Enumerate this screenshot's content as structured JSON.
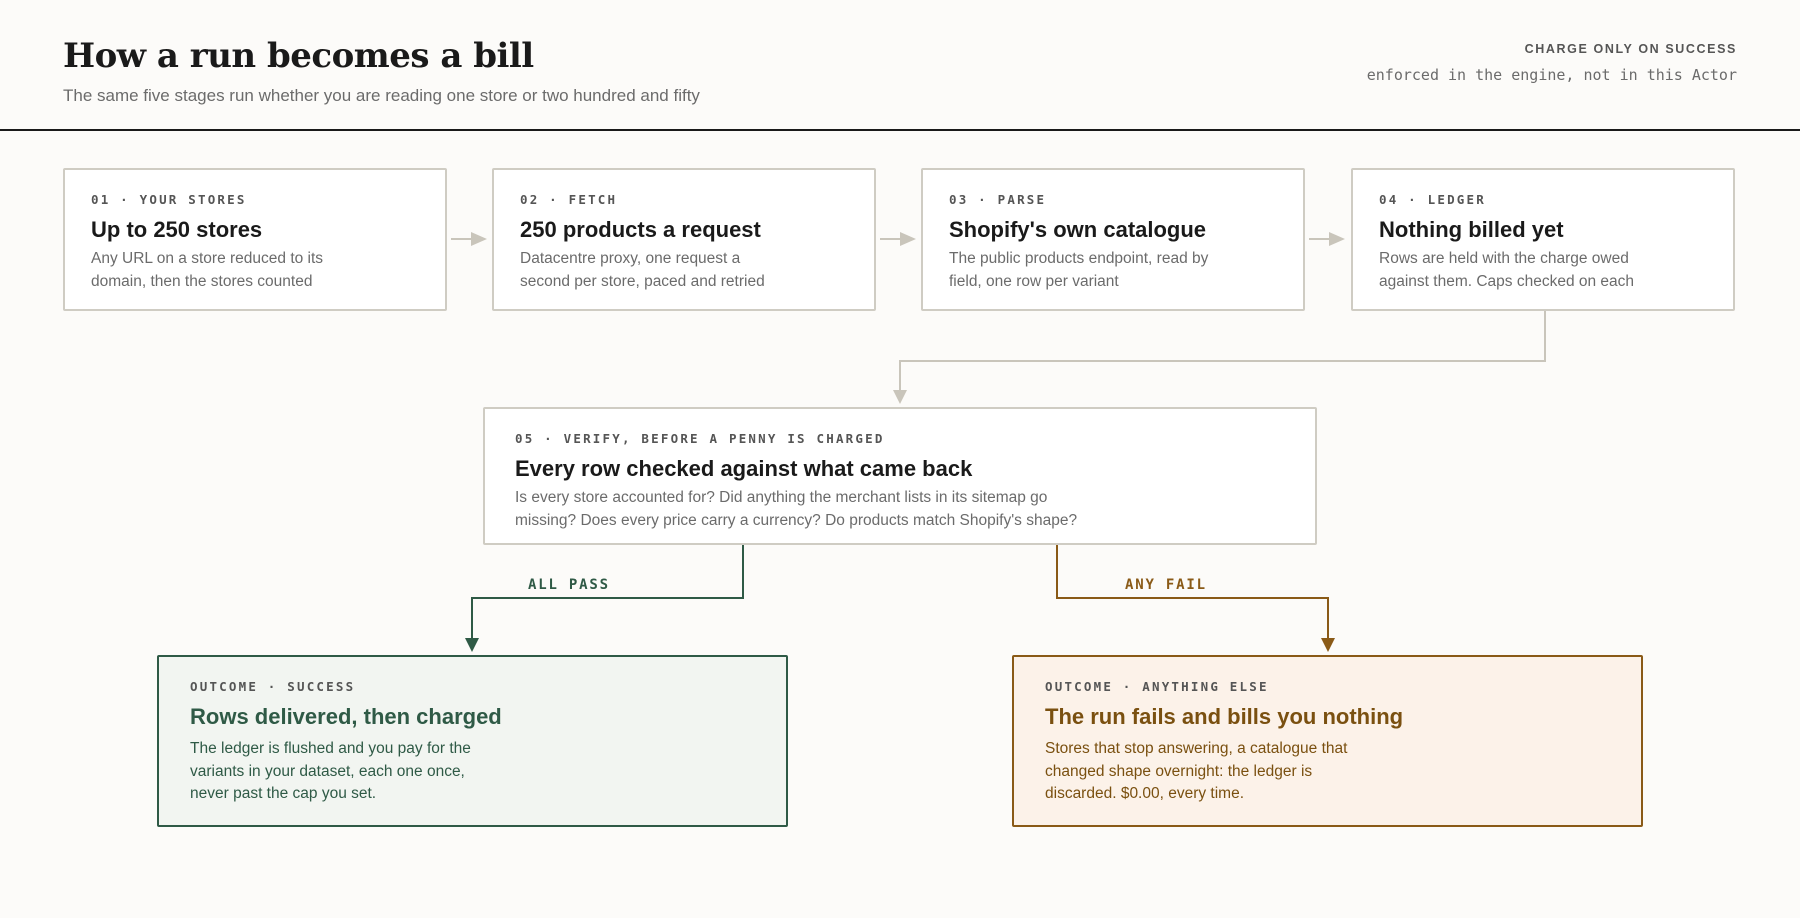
{
  "header": {
    "title": "How a run becomes a bill",
    "subtitle": "The same five stages run whether you are reading one store or two hundred and fifty",
    "kicker": "CHARGE ONLY ON SUCCESS",
    "note": "enforced in the engine, not in this Actor"
  },
  "stages": [
    {
      "kicker": "01 · YOUR STORES",
      "title": "Up to 250 stores",
      "desc": "Any URL on a store reduced to its domain, then the stores counted"
    },
    {
      "kicker": "02 · FETCH",
      "title": "250 products a request",
      "desc": "Datacentre proxy, one request a second per store, paced and retried"
    },
    {
      "kicker": "03 · PARSE",
      "title": "Shopify's own catalogue",
      "desc": "The public products endpoint, read by field, one row per variant"
    },
    {
      "kicker": "04 · LEDGER",
      "title": "Nothing billed yet",
      "desc": "Rows are held with the charge owed against them. Caps checked on each"
    }
  ],
  "verify": {
    "kicker": "05 · VERIFY, BEFORE A PENNY IS CHARGED",
    "title": "Every row checked against what came back",
    "desc": "Is every store accounted for? Did anything the merchant lists in its sitemap go missing? Does every price carry a currency? Do products match Shopify's shape?"
  },
  "branches": {
    "pass": "ALL PASS",
    "fail": "ANY FAIL"
  },
  "outcomes": {
    "success": {
      "kicker": "OUTCOME · SUCCESS",
      "title": "Rows delivered, then charged",
      "desc": "The ledger is flushed and you pay for the variants in your dataset, each one once, never past the cap you set."
    },
    "fail": {
      "kicker": "OUTCOME · ANYTHING ELSE",
      "title": "The run fails and bills you nothing",
      "desc": "Stores that stop answering, a catalogue that changed shape overnight: the ledger is discarded. $0.00, every time."
    }
  },
  "colors": {
    "success": "#2f5a46",
    "fail": "#8a5a17",
    "connector": "#c9c5bb",
    "rule": "#1a1a1a"
  }
}
